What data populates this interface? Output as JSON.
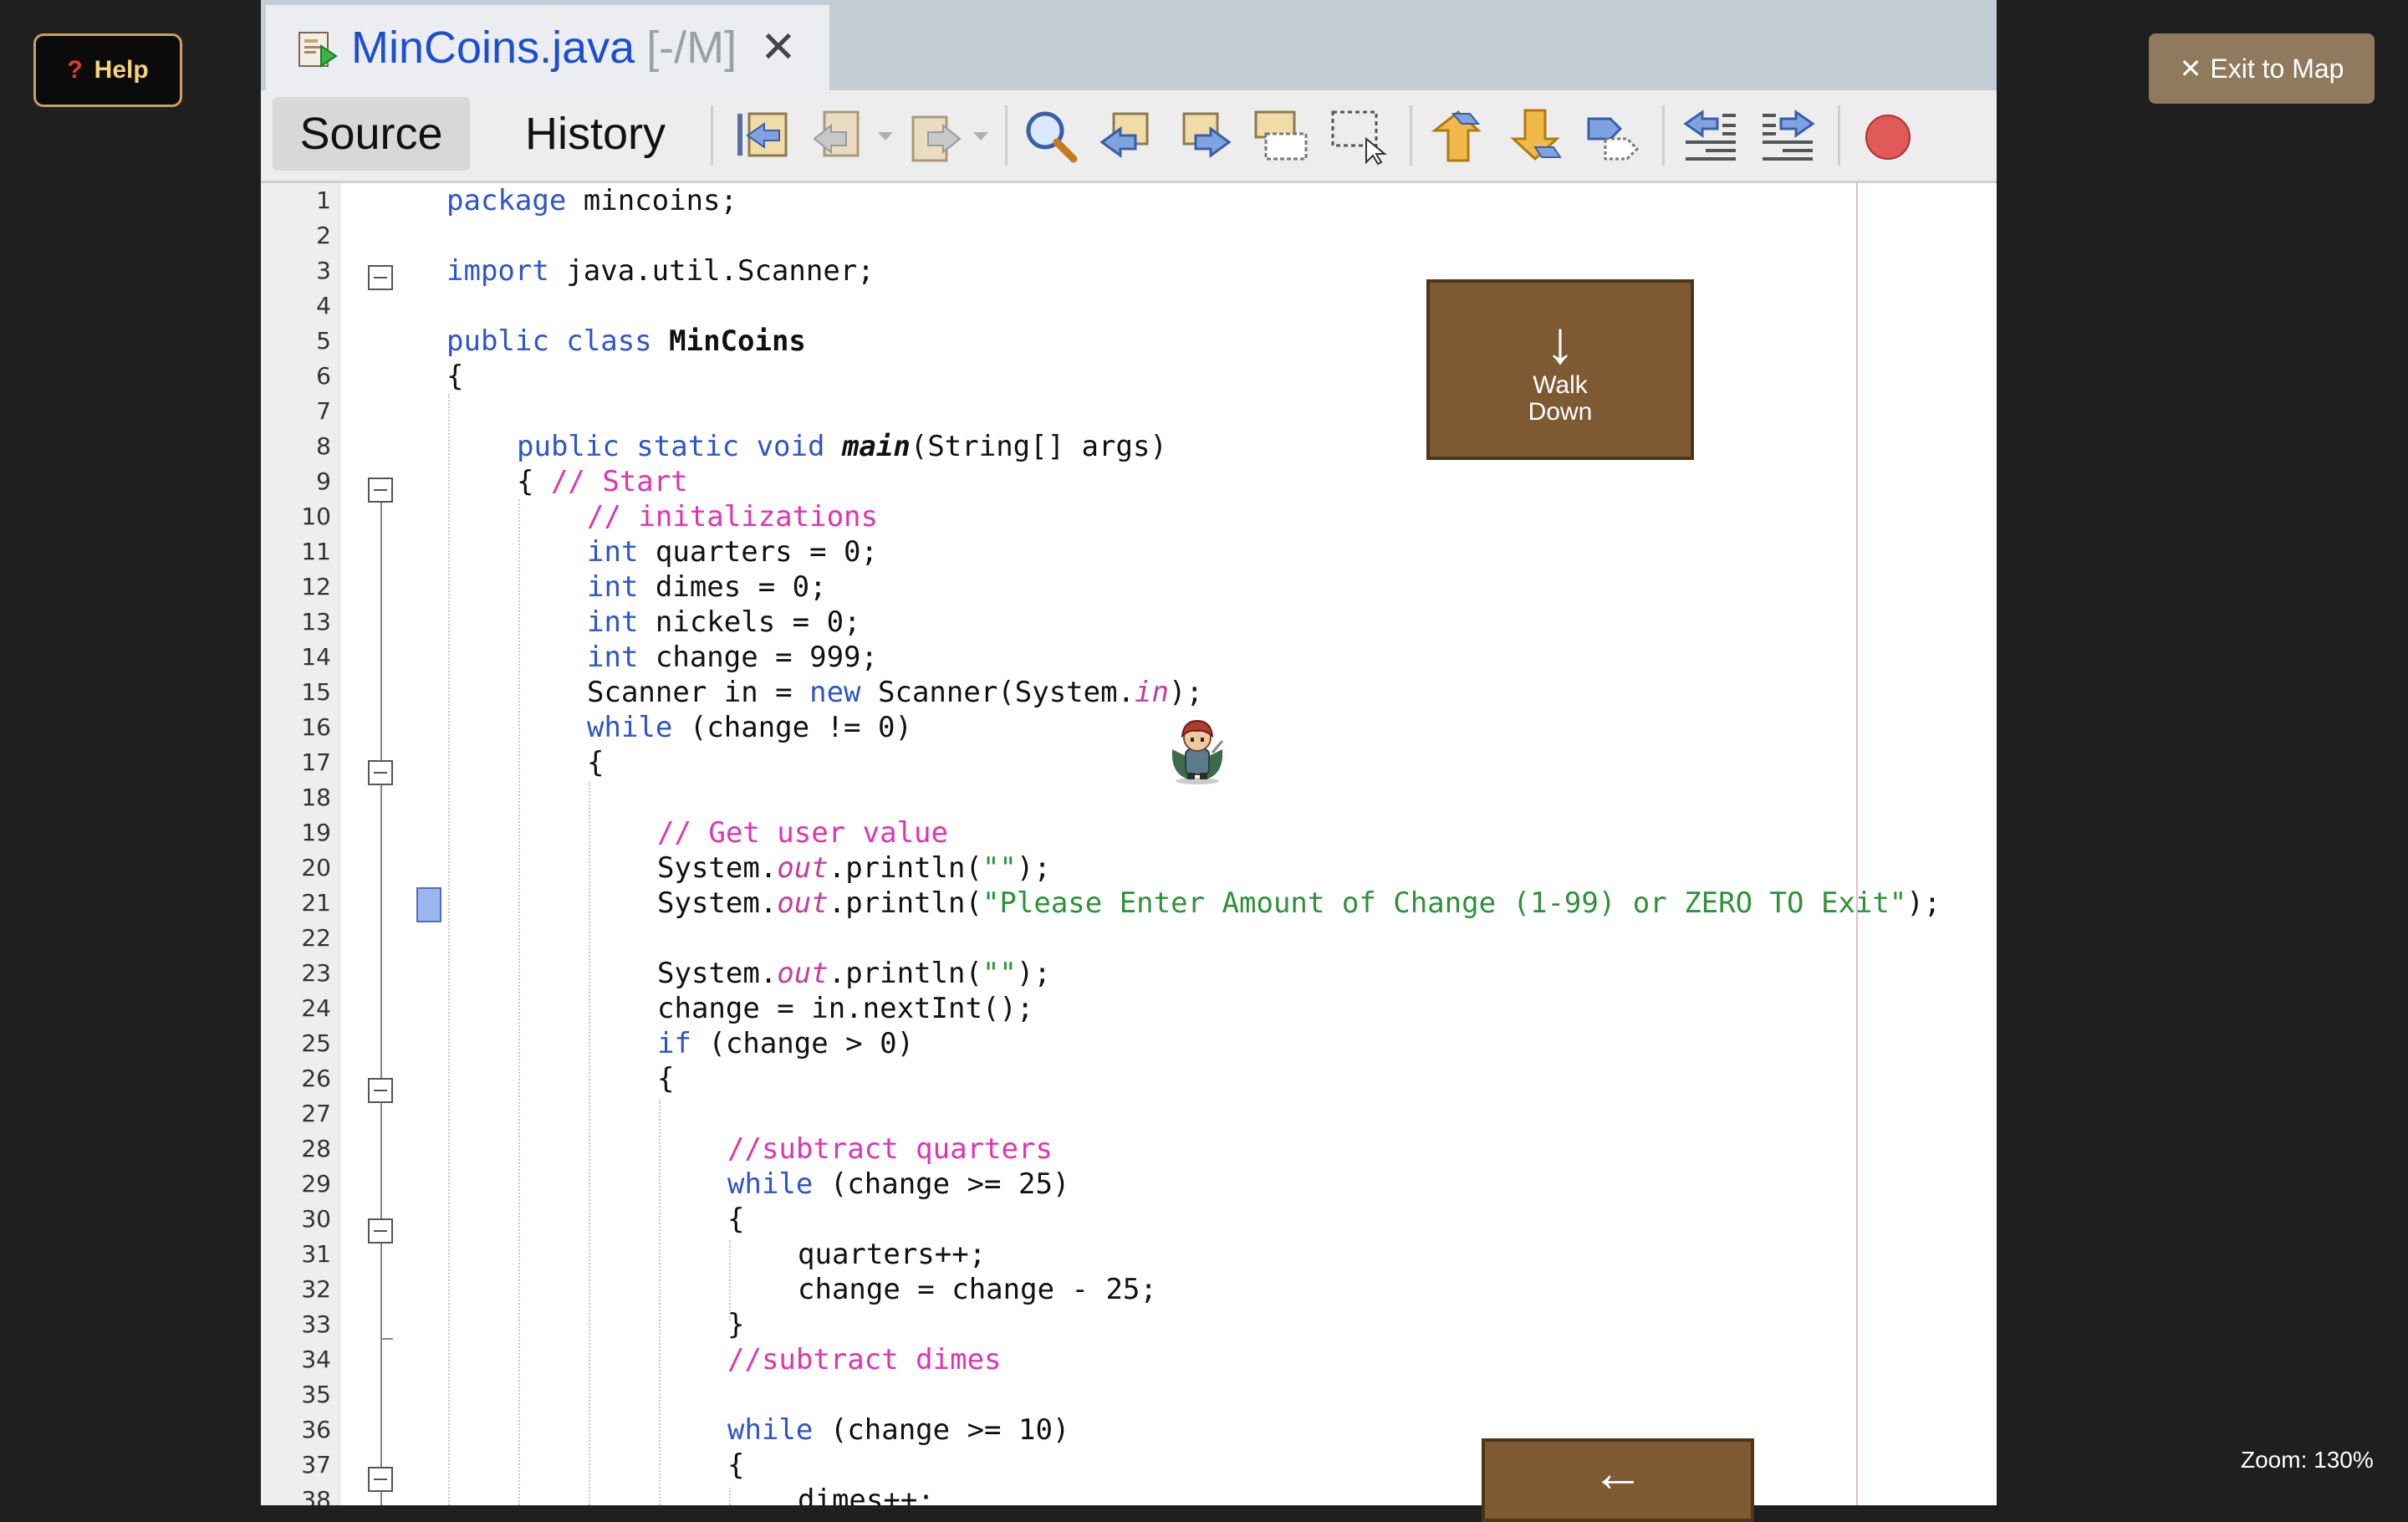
{
  "help_button": {
    "icon": "question-icon",
    "glyph": "?",
    "label": "Help"
  },
  "exit_button": {
    "glyph": "✕",
    "label": "Exit to Map"
  },
  "zoom": {
    "label": "Zoom: 130%"
  },
  "editor_tab": {
    "name": "MinCoins.java",
    "path": "[-/M]",
    "close": "✕"
  },
  "toolbar": {
    "source_label": "Source",
    "history_label": "History",
    "icons": [
      "last-edit-icon",
      "back-icon",
      "forward-icon",
      "find-icon",
      "find-previous-icon",
      "find-next-icon",
      "toggle-highlight-icon",
      "rectangular-select-icon",
      "previous-bookmark-icon",
      "next-bookmark-icon",
      "toggle-bookmark-icon",
      "shift-left-icon",
      "shift-right-icon",
      "record-macro-icon"
    ]
  },
  "line_numbers": [
    "1",
    "2",
    "3",
    "4",
    "5",
    "6",
    "7",
    "8",
    "9",
    "10",
    "11",
    "12",
    "13",
    "14",
    "15",
    "16",
    "17",
    "18",
    "19",
    "20",
    "21",
    "22",
    "23",
    "24",
    "25",
    "26",
    "27",
    "28",
    "29",
    "30",
    "31",
    "32",
    "33",
    "34",
    "35",
    "36",
    "37",
    "38"
  ],
  "code": {
    "l1": {
      "kw": "package",
      "rest": " mincoins;"
    },
    "l3": {
      "kw": "import",
      "rest": " java.util.Scanner;"
    },
    "l5": {
      "kw": "public class",
      "name": "MinCoins"
    },
    "l6": "{",
    "l8": {
      "kw": "public static void",
      "name": "main",
      "rest": "(String[] args)"
    },
    "l9": {
      "brace": "{ ",
      "comment": "// Start"
    },
    "l10": "// initalizations",
    "l11": {
      "kw": "int",
      "rest": " quarters = 0;"
    },
    "l12": {
      "kw": "int",
      "rest": " dimes = 0;"
    },
    "l13": {
      "kw": "int",
      "rest": " nickels = 0;"
    },
    "l14": {
      "kw": "int",
      "rest": " change = 999;"
    },
    "l15": {
      "a": "Scanner in = ",
      "kw": "new",
      "b": " Scanner(System.",
      "it": "in",
      "c": ");"
    },
    "l16": {
      "kw": "while",
      "rest": " (change != 0)"
    },
    "l17": "{",
    "l19": "// Get user value",
    "l20": {
      "a": "System.",
      "it": "out",
      "b": ".println(",
      "str": "\"\"",
      "c": ");"
    },
    "l21": {
      "a": "System.",
      "it": "out",
      "b": ".println(",
      "str": "\"Please Enter Amount of Change (1-99) or ZERO TO Exit\"",
      "c": ");"
    },
    "l23": {
      "a": "System.",
      "it": "out",
      "b": ".println(",
      "str": "\"\"",
      "c": ");"
    },
    "l24": "change = in.nextInt();",
    "l25": {
      "kw": "if",
      "rest": " (change > 0)"
    },
    "l26": "{",
    "l28": "//subtract quarters",
    "l29": {
      "kw": "while",
      "rest": " (change >= 25)"
    },
    "l30": "{",
    "l31": "quarters++;",
    "l32": "change = change - 25;",
    "l33": "}",
    "l34": "//subtract dimes",
    "l36": {
      "kw": "while",
      "rest": " (change >= 10)"
    },
    "l37": "{",
    "l38": "dimes++;"
  },
  "walk_down_button": {
    "arrow": "↓",
    "label_line1": "Walk",
    "label_line2": "Down"
  },
  "back_button": {
    "arrow": "←"
  },
  "colors": {
    "keyword": "#2e55c9",
    "comment": "#e033b0",
    "string": "#2e9138",
    "field": "#c23d9a",
    "button_brown": "#7e5a33"
  }
}
